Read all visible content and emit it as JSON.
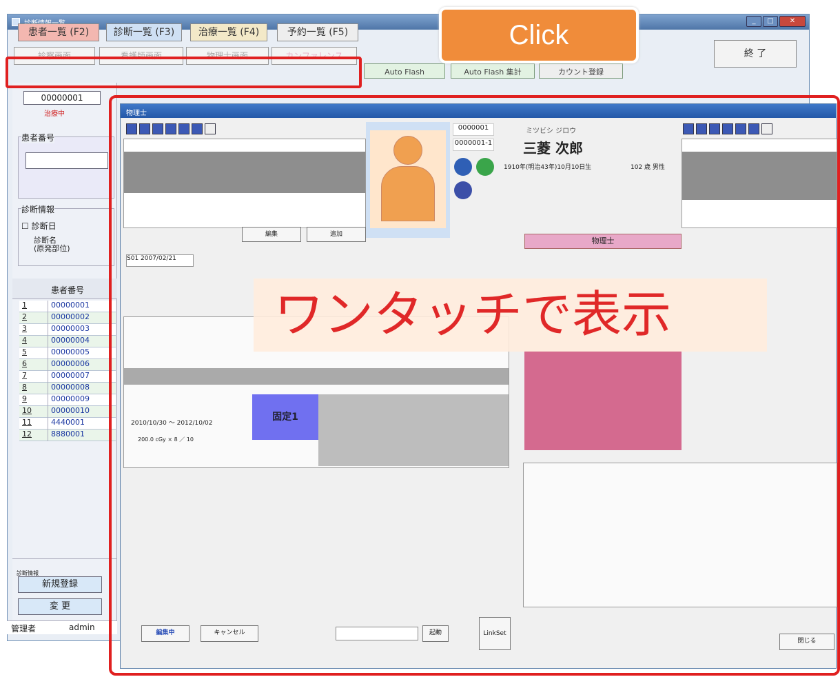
{
  "main_window": {
    "title": "診断情報一覧",
    "tabs": [
      "患者一覧 (F2)",
      "診断一覧 (F3)",
      "治療一覧 (F4)",
      "予約一覧 (F5)"
    ],
    "subtabs": [
      "診察画面",
      "看護師画面",
      "物理士画面",
      "カンファレンス"
    ],
    "extra_buttons": [
      "Auto Flash",
      "Auto Flash 集計",
      "カウント登録"
    ],
    "exit_label": "終 了",
    "patient_id": "00000001",
    "patient_status": "治療中",
    "patient_no_label": "患者番号",
    "diag_info_label": "診断情報",
    "diag_date_label": "診断日",
    "diag_name_label": "診断名\n(原発部位)",
    "grid_header": "患者番号",
    "rows": [
      {
        "n": "1",
        "id": "00000001"
      },
      {
        "n": "2",
        "id": "00000002"
      },
      {
        "n": "3",
        "id": "00000003"
      },
      {
        "n": "4",
        "id": "00000004"
      },
      {
        "n": "5",
        "id": "00000005"
      },
      {
        "n": "6",
        "id": "00000006"
      },
      {
        "n": "7",
        "id": "00000007"
      },
      {
        "n": "8",
        "id": "00000008"
      },
      {
        "n": "9",
        "id": "00000009"
      },
      {
        "n": "10",
        "id": "00000010"
      },
      {
        "n": "11",
        "id": "4440001"
      },
      {
        "n": "12",
        "id": "8880001"
      }
    ],
    "footer_section_label": "診断情報",
    "new_button": "新規登録",
    "change_button": "変 更",
    "user_label": "管理者",
    "user_value": "admin"
  },
  "popup_window": {
    "title": "物理士",
    "patient_no_1": "0000001",
    "patient_no_2": "0000001-1",
    "kana_name": "ミツビシ ジロウ",
    "name": "三菱 次郎",
    "birth": "1910年(明治43年)10月10日生",
    "age": "102 歳 男性",
    "diagnosis_header": "物理士",
    "cancel_button": "キャンセル",
    "edit_button": "編集中",
    "start_button": "起動",
    "linkset_button": "LinkSet",
    "close_button": "閉じる",
    "image_label": "固定1",
    "date_range": "2010/10/30 〜 2012/10/02",
    "dose": "200.0 cGy ×  8 ／ 10",
    "left_date": "S01 2007/02/21"
  },
  "callout": {
    "text": "Click"
  },
  "banner": {
    "text": "ワンタッチで表示"
  }
}
